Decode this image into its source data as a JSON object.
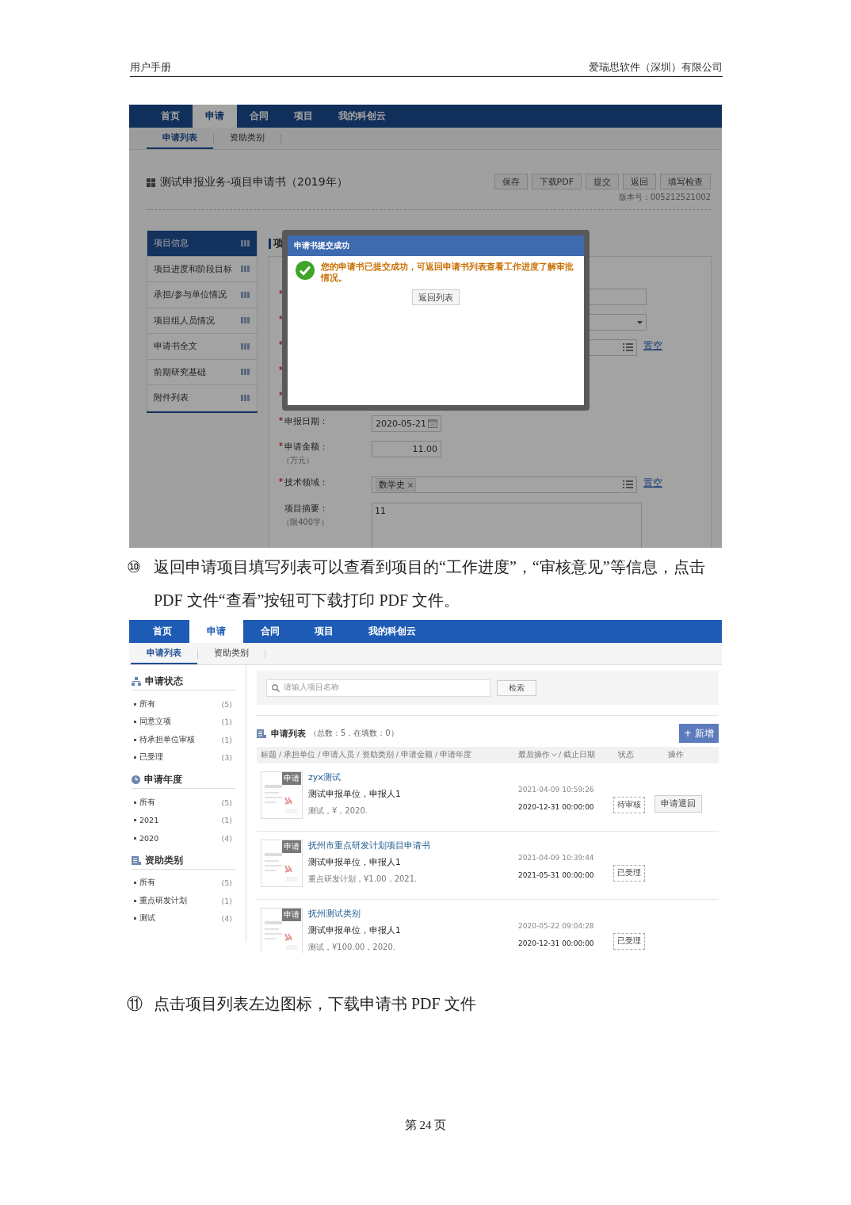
{
  "document_header": {
    "left": "用户手册",
    "right": "爱瑞思软件（深圳）有限公司"
  },
  "screenshot_1": {
    "nav_tabs": [
      {
        "label": "首页",
        "selected": false
      },
      {
        "label": "申请",
        "selected": true
      },
      {
        "label": "合同",
        "selected": false
      },
      {
        "label": "项目",
        "selected": false
      },
      {
        "label": "我的科创云",
        "selected": false
      }
    ],
    "sub_tabs": [
      {
        "label": "申请列表",
        "selected": true
      },
      {
        "label": "资助类别",
        "selected": false
      }
    ],
    "title": "测试申报业务-项目申请书（2019年）",
    "buttons": [
      "保存",
      "下载PDF",
      "提交",
      "返回",
      "填写检查"
    ],
    "version": "版本号：005212521002",
    "side_menu": [
      {
        "label": "项目信息",
        "selected": true
      },
      {
        "label": "项目进度和阶段目标",
        "selected": false
      },
      {
        "label": "承担/参与单位情况",
        "selected": false
      },
      {
        "label": "项目组人员情况",
        "selected": false
      },
      {
        "label": "申请书全文",
        "selected": false
      },
      {
        "label": "前期研究基础",
        "selected": false
      },
      {
        "label": "附件列表",
        "selected": false
      }
    ],
    "section_title": "项",
    "hidden_rows": [
      {
        "kind": "input",
        "required": true
      },
      {
        "kind": "select",
        "required": true
      },
      {
        "kind": "picker",
        "required": true,
        "action": "置空"
      },
      {
        "kind": "blank",
        "required": true
      },
      {
        "kind": "blank",
        "required": true
      }
    ],
    "form_rows": [
      {
        "kind": "date",
        "label": "申报日期：",
        "required": true,
        "value": "2020-05-21"
      },
      {
        "kind": "amount",
        "label": "申请金额：",
        "hint": "（万元）",
        "required": true,
        "value": "11.00"
      },
      {
        "kind": "tags",
        "label": "技术领域：",
        "required": true,
        "tags": [
          "数学史"
        ],
        "action": "置空"
      },
      {
        "kind": "textarea",
        "label": "项目摘要：",
        "hint": "（限400字）",
        "required": false,
        "value": "11"
      }
    ],
    "dialog": {
      "title": "申请书提交成功",
      "message": "您的申请书已提交成功，可返回申请书列表查看工作进度了解审批情况。",
      "button": "返回列表"
    }
  },
  "steps": [
    {
      "number": "⑩",
      "text": "返回申请项目填写列表可以查看到项目的“工作进度”，“审核意见”等信息，点击 PDF 文件“查看”按钮可下载打印 PDF 文件。"
    }
  ],
  "screenshot_2": {
    "nav_tabs": [
      {
        "label": "首页",
        "selected": false
      },
      {
        "label": "申请",
        "selected": true
      },
      {
        "label": "合同",
        "selected": false
      },
      {
        "label": "项目",
        "selected": false
      },
      {
        "label": "我的科创云",
        "selected": false
      }
    ],
    "sub_tabs": [
      {
        "label": "申请列表",
        "selected": true
      },
      {
        "label": "资助类别",
        "selected": false
      }
    ],
    "filter_groups": [
      {
        "title": "申请状态",
        "items": [
          {
            "label": "所有",
            "count": "(5)"
          },
          {
            "label": "同意立项",
            "count": "(1)"
          },
          {
            "label": "待承担单位审核",
            "count": "(1)"
          },
          {
            "label": "已受理",
            "count": "(3)"
          }
        ]
      },
      {
        "title": "申请年度",
        "items": [
          {
            "label": "所有",
            "count": "(5)"
          },
          {
            "label": "2021",
            "count": "(1)"
          },
          {
            "label": "2020",
            "count": "(4)"
          }
        ]
      },
      {
        "title": "资助类别",
        "items": [
          {
            "label": "所有",
            "count": "(5)"
          },
          {
            "label": "重点研发计划",
            "count": "(1)"
          },
          {
            "label": "测试",
            "count": "(4)"
          }
        ]
      }
    ],
    "search": {
      "placeholder": "请输入项目名称",
      "button": "检索"
    },
    "list_title": "申请列表",
    "list_summary": "（总数：5，在填数：0）",
    "add_button": "+ 新增",
    "columns": {
      "main": "标题 / 承担单位 / 申请人员 / 资助类别 / 申请金额 / 申请年度",
      "last_op": "最后操作",
      "deadline": "/ 截止日期",
      "status": "状态",
      "action": "操作"
    },
    "rows": [
      {
        "tag": "申请",
        "title": "zyx测试",
        "unit": "测试申报单位，申报人1",
        "meta": "测试，¥，2020.",
        "last_op": "2021-04-09 10:59:26",
        "deadline": "2020-12-31 00:00:00",
        "status": "待审核",
        "action": "申请退回"
      },
      {
        "tag": "申请",
        "title": "抚州市重点研发计划项目申请书",
        "unit": "测试申报单位，申报人1",
        "meta": "重点研发计划，¥1.00，2021.",
        "last_op": "2021-04-09 10:39:44",
        "deadline": "2021-05-31 00:00:00",
        "status": "已受理"
      },
      {
        "tag": "申请",
        "title": "抚州测试类别",
        "unit": "测试申报单位，申报人1",
        "meta": "测试，¥100.00，2020.",
        "last_op": "2020-05-22 09:04:28",
        "deadline": "2020-12-31 00:00:00",
        "status": "已受理"
      }
    ]
  },
  "steps_2": [
    {
      "number": "⑪",
      "text": "点击项目列表左边图标，下载申请书 PDF 文件"
    }
  ],
  "footer": "第 24 页"
}
